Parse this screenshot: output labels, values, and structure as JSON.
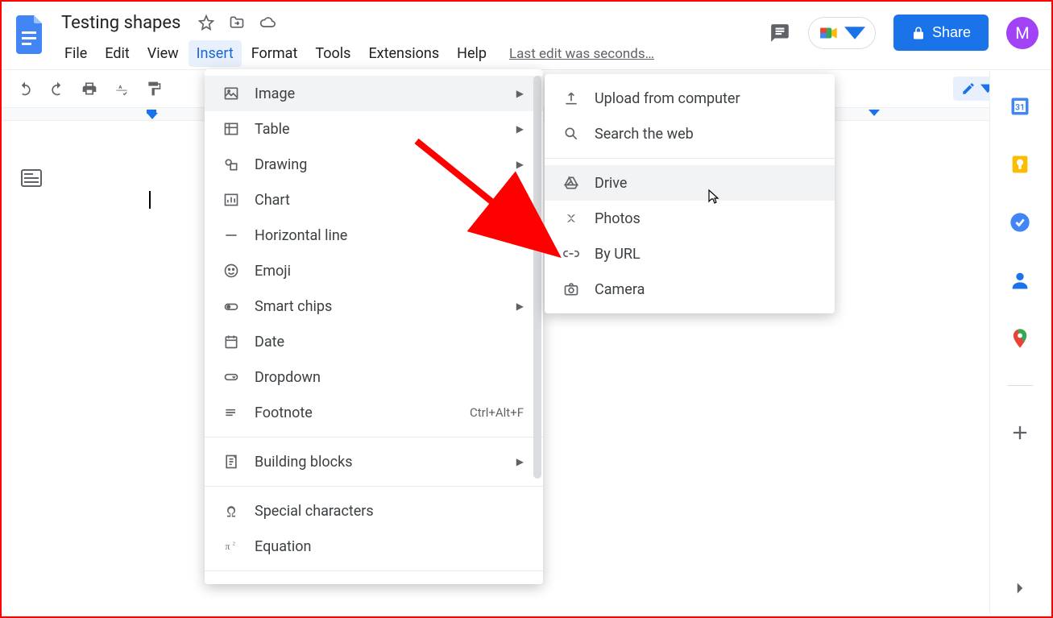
{
  "doc": {
    "title": "Testing shapes"
  },
  "menus": {
    "file": "File",
    "edit": "Edit",
    "view": "View",
    "insert": "Insert",
    "format": "Format",
    "tools": "Tools",
    "extensions": "Extensions",
    "help": "Help"
  },
  "edit_status": "Last edit was seconds…",
  "share_label": "Share",
  "avatar_letter": "M",
  "insert_menu": {
    "image": "Image",
    "table": "Table",
    "drawing": "Drawing",
    "chart": "Chart",
    "hline": "Horizontal line",
    "emoji": "Emoji",
    "smart_chips": "Smart chips",
    "date": "Date",
    "dropdown": "Dropdown",
    "footnote": "Footnote",
    "footnote_shortcut": "Ctrl+Alt+F",
    "building_blocks": "Building blocks",
    "special_chars": "Special characters",
    "equation": "Equation"
  },
  "image_submenu": {
    "upload": "Upload from computer",
    "search": "Search the web",
    "drive": "Drive",
    "photos": "Photos",
    "by_url": "By URL",
    "camera": "Camera"
  }
}
